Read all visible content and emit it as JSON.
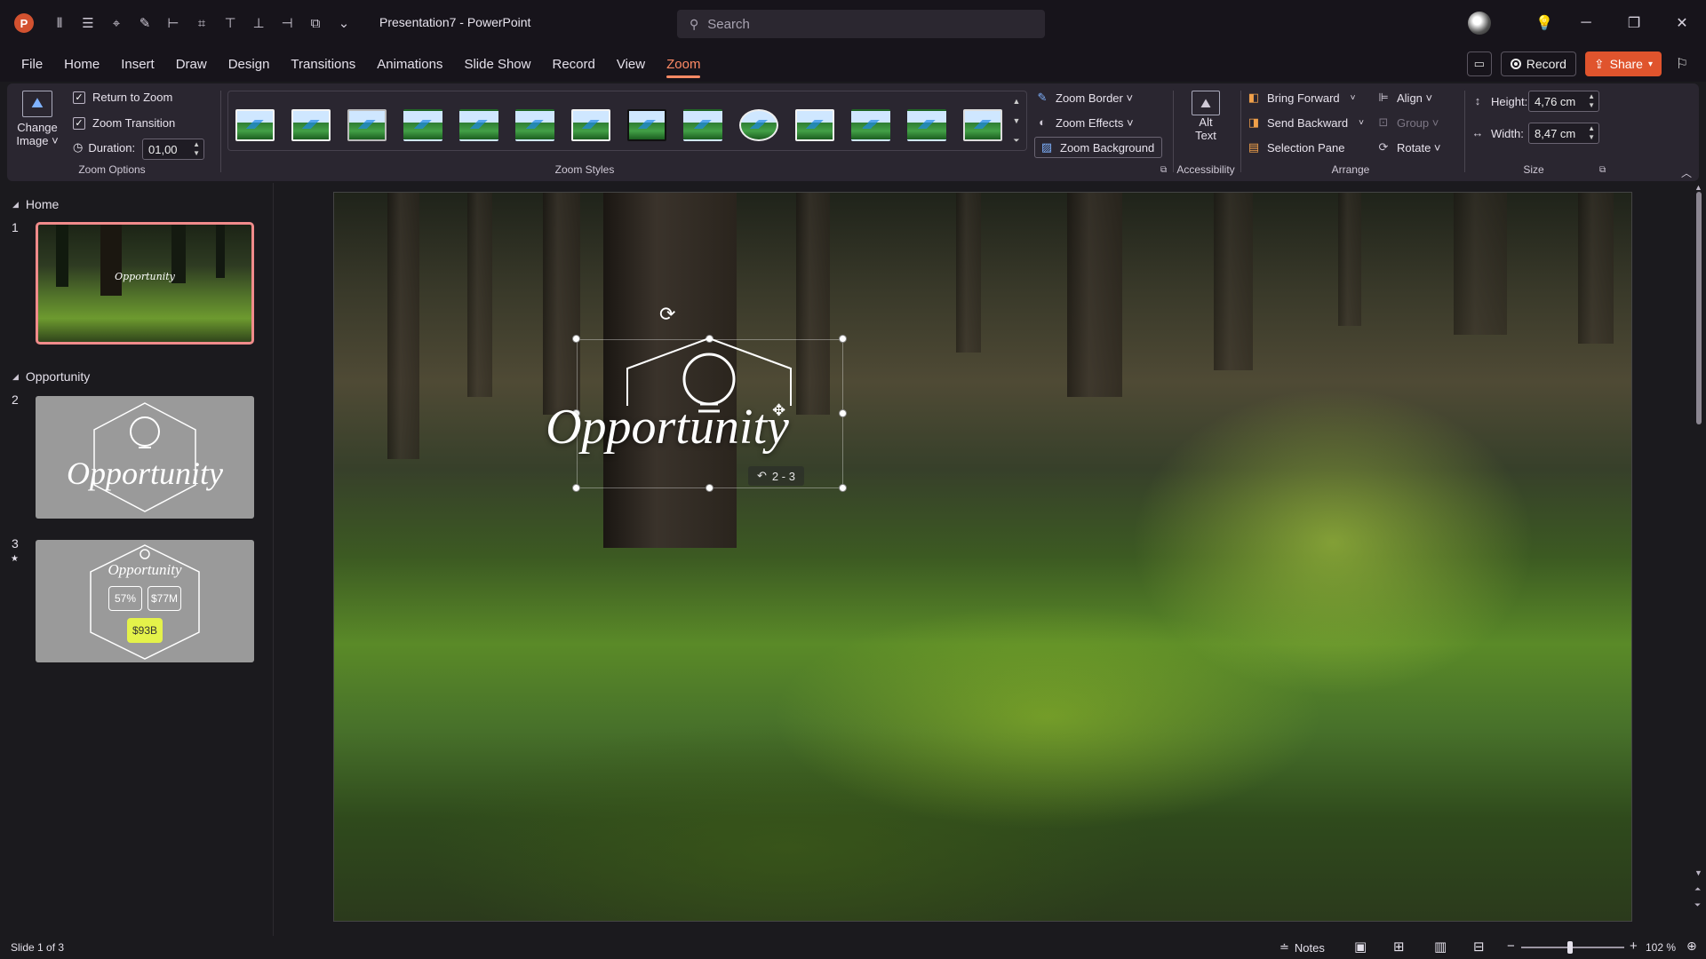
{
  "app": {
    "document_title": "Presentation7  -  PowerPoint",
    "search_placeholder": "Search"
  },
  "menu": {
    "tabs": [
      "File",
      "Home",
      "Insert",
      "Draw",
      "Design",
      "Transitions",
      "Animations",
      "Slide Show",
      "Record",
      "View",
      "Zoom"
    ],
    "active_tab": "Zoom",
    "record_label": "Record",
    "share_label": "Share"
  },
  "ribbon": {
    "zoom_options": {
      "change_image_line1": "Change",
      "change_image_line2": "Image ˅",
      "return_to_zoom": "Return to Zoom",
      "return_to_zoom_checked": true,
      "zoom_transition": "Zoom Transition",
      "zoom_transition_checked": true,
      "duration_label": "Duration:",
      "duration_value": "01,00",
      "group_label": "Zoom Options"
    },
    "zoom_styles": {
      "group_label": "Zoom Styles",
      "zoom_border": "Zoom Border ˅",
      "zoom_effects": "Zoom Effects ˅",
      "zoom_background": "Zoom Background"
    },
    "accessibility": {
      "alt_text_line1": "Alt",
      "alt_text_line2": "Text",
      "group_label": "Accessibility"
    },
    "arrange": {
      "bring_forward": "Bring Forward",
      "send_backward": "Send Backward",
      "selection_pane": "Selection Pane",
      "align": "Align ˅",
      "group": "Group ˅",
      "rotate": "Rotate ˅",
      "group_label": "Arrange"
    },
    "size": {
      "height_label": "Height:",
      "height_value": "4,76 cm",
      "width_label": "Width:",
      "width_value": "8,47 cm",
      "group_label": "Size"
    }
  },
  "slides_panel": {
    "sections": [
      {
        "name": "Home"
      },
      {
        "name": "Opportunity"
      }
    ],
    "slides": [
      {
        "number": "1",
        "caption": "Opportunity"
      },
      {
        "number": "2",
        "caption": "Opportunity"
      },
      {
        "number": "3",
        "caption": "Opportunity",
        "stats": [
          "57%",
          "$77M",
          "$93B"
        ]
      }
    ]
  },
  "canvas": {
    "title": "Opportunity",
    "return_tag": "2 - 3"
  },
  "status": {
    "slide_info": "Slide 1 of 3",
    "notes": "Notes",
    "zoom": "102 %"
  }
}
